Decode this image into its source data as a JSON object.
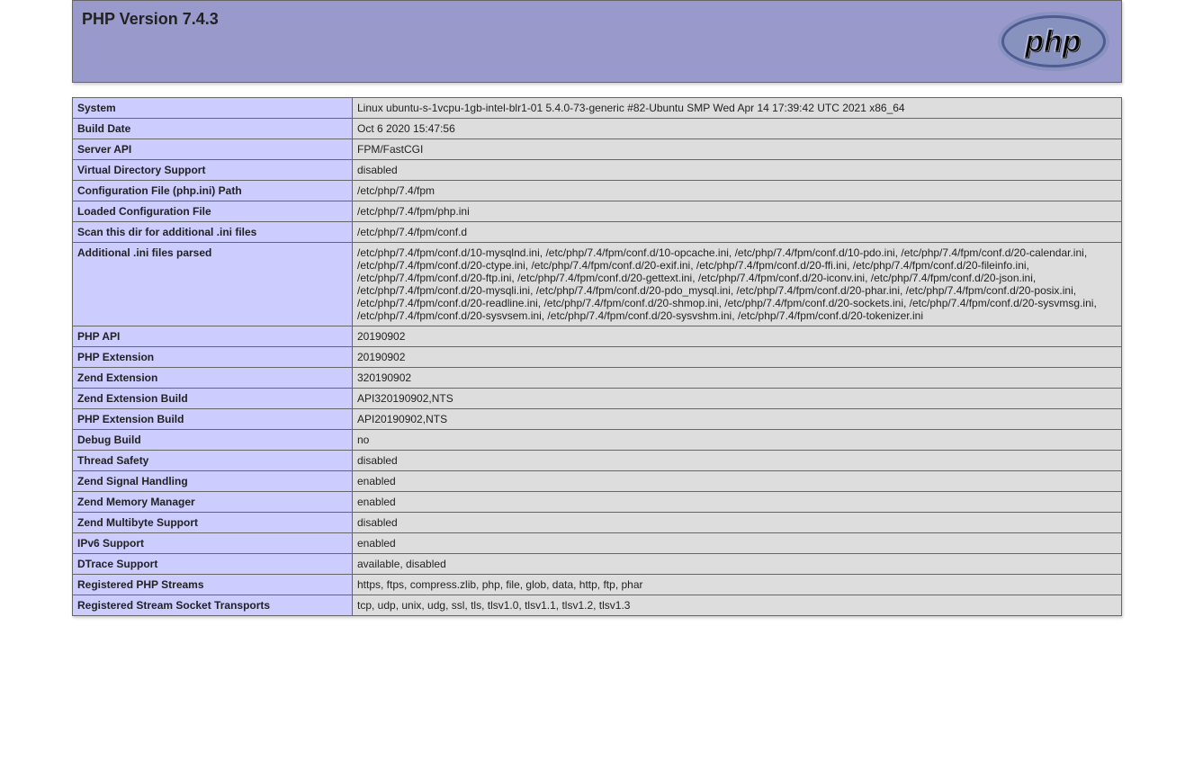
{
  "header": {
    "title": "PHP Version 7.4.3"
  },
  "rows": [
    {
      "key": "System",
      "value": "Linux ubuntu-s-1vcpu-1gb-intel-blr1-01 5.4.0-73-generic #82-Ubuntu SMP Wed Apr 14 17:39:42 UTC 2021 x86_64"
    },
    {
      "key": "Build Date",
      "value": "Oct 6 2020 15:47:56"
    },
    {
      "key": "Server API",
      "value": "FPM/FastCGI"
    },
    {
      "key": "Virtual Directory Support",
      "value": "disabled"
    },
    {
      "key": "Configuration File (php.ini) Path",
      "value": "/etc/php/7.4/fpm"
    },
    {
      "key": "Loaded Configuration File",
      "value": "/etc/php/7.4/fpm/php.ini"
    },
    {
      "key": "Scan this dir for additional .ini files",
      "value": "/etc/php/7.4/fpm/conf.d"
    },
    {
      "key": "Additional .ini files parsed",
      "value": "/etc/php/7.4/fpm/conf.d/10-mysqlnd.ini, /etc/php/7.4/fpm/conf.d/10-opcache.ini, /etc/php/7.4/fpm/conf.d/10-pdo.ini, /etc/php/7.4/fpm/conf.d/20-calendar.ini, /etc/php/7.4/fpm/conf.d/20-ctype.ini, /etc/php/7.4/fpm/conf.d/20-exif.ini, /etc/php/7.4/fpm/conf.d/20-ffi.ini, /etc/php/7.4/fpm/conf.d/20-fileinfo.ini, /etc/php/7.4/fpm/conf.d/20-ftp.ini, /etc/php/7.4/fpm/conf.d/20-gettext.ini, /etc/php/7.4/fpm/conf.d/20-iconv.ini, /etc/php/7.4/fpm/conf.d/20-json.ini, /etc/php/7.4/fpm/conf.d/20-mysqli.ini, /etc/php/7.4/fpm/conf.d/20-pdo_mysql.ini, /etc/php/7.4/fpm/conf.d/20-phar.ini, /etc/php/7.4/fpm/conf.d/20-posix.ini, /etc/php/7.4/fpm/conf.d/20-readline.ini, /etc/php/7.4/fpm/conf.d/20-shmop.ini, /etc/php/7.4/fpm/conf.d/20-sockets.ini, /etc/php/7.4/fpm/conf.d/20-sysvmsg.ini, /etc/php/7.4/fpm/conf.d/20-sysvsem.ini, /etc/php/7.4/fpm/conf.d/20-sysvshm.ini, /etc/php/7.4/fpm/conf.d/20-tokenizer.ini"
    },
    {
      "key": "PHP API",
      "value": "20190902"
    },
    {
      "key": "PHP Extension",
      "value": "20190902"
    },
    {
      "key": "Zend Extension",
      "value": "320190902"
    },
    {
      "key": "Zend Extension Build",
      "value": "API320190902,NTS"
    },
    {
      "key": "PHP Extension Build",
      "value": "API20190902,NTS"
    },
    {
      "key": "Debug Build",
      "value": "no"
    },
    {
      "key": "Thread Safety",
      "value": "disabled"
    },
    {
      "key": "Zend Signal Handling",
      "value": "enabled"
    },
    {
      "key": "Zend Memory Manager",
      "value": "enabled"
    },
    {
      "key": "Zend Multibyte Support",
      "value": "disabled"
    },
    {
      "key": "IPv6 Support",
      "value": "enabled"
    },
    {
      "key": "DTrace Support",
      "value": "available, disabled"
    },
    {
      "key": "Registered PHP Streams",
      "value": "https, ftps, compress.zlib, php, file, glob, data, http, ftp, phar"
    },
    {
      "key": "Registered Stream Socket Transports",
      "value": "tcp, udp, unix, udg, ssl, tls, tlsv1.0, tlsv1.1, tlsv1.2, tlsv1.3"
    }
  ]
}
